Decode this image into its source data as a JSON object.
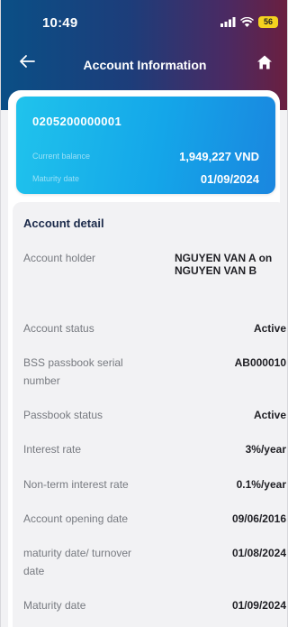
{
  "status_bar": {
    "time": "10:49",
    "battery": "56"
  },
  "nav": {
    "title": "Account Information",
    "back_icon": "arrow-left-icon",
    "home_icon": "home-icon"
  },
  "card": {
    "account_number": "0205200000001",
    "current_balance_label": "Current balance",
    "current_balance_value": "1,949,227 VND",
    "maturity_date_label": "Maturity date",
    "maturity_date_value": "01/09/2024",
    "gradient": [
      "#20c3ec",
      "#1a86df"
    ]
  },
  "detail": {
    "title": "Account detail",
    "rows": [
      {
        "label": "Account holder",
        "value": "NGUYEN VAN A on NGUYEN VAN B"
      },
      {
        "label": "Account status",
        "value": "Active"
      },
      {
        "label": "BSS passbook serial number",
        "value": "AB000010"
      },
      {
        "label": "Passbook status",
        "value": "Active"
      },
      {
        "label": "Interest rate",
        "value": "3%/year"
      },
      {
        "label": "Non-term interest rate",
        "value": "0.1%/year"
      },
      {
        "label": "Account opening date",
        "value": "09/06/2016"
      },
      {
        "label": "maturity date/ turnover date",
        "value": "01/08/2024"
      },
      {
        "label": "Maturity date",
        "value": "01/09/2024"
      }
    ]
  },
  "colors": {
    "accent": "#1b2a4a",
    "header_start": "#0a4f86",
    "header_end": "#6b1f3f"
  }
}
